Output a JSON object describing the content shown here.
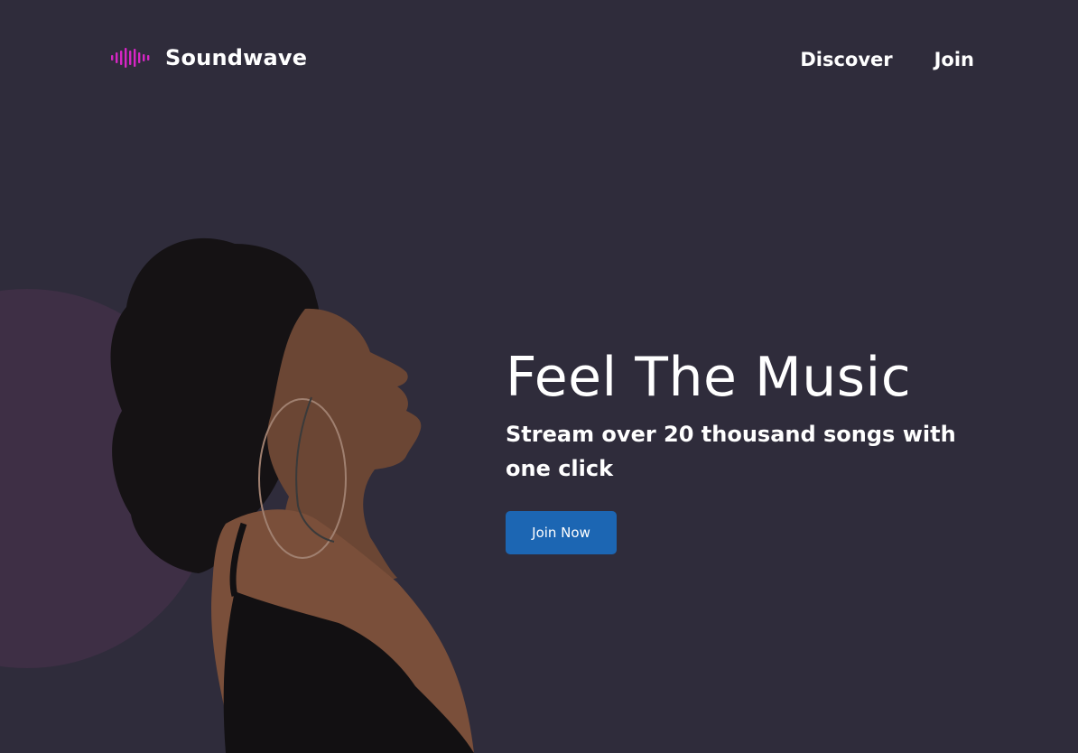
{
  "brand": {
    "name": "Soundwave",
    "icon": "soundwave-bars-icon",
    "accent_color": "#d626c4"
  },
  "nav": {
    "items": [
      {
        "label": "Discover"
      },
      {
        "label": "Join"
      }
    ]
  },
  "hero": {
    "title": "Feel The Music",
    "subtitle": "Stream over 20 thousand songs with one click",
    "cta_label": "Join Now",
    "cta_color": "#1c66b3",
    "image": "woman-listening-with-eyes-closed"
  },
  "colors": {
    "background": "#2f2c3b",
    "circle": "#3e2f45"
  }
}
